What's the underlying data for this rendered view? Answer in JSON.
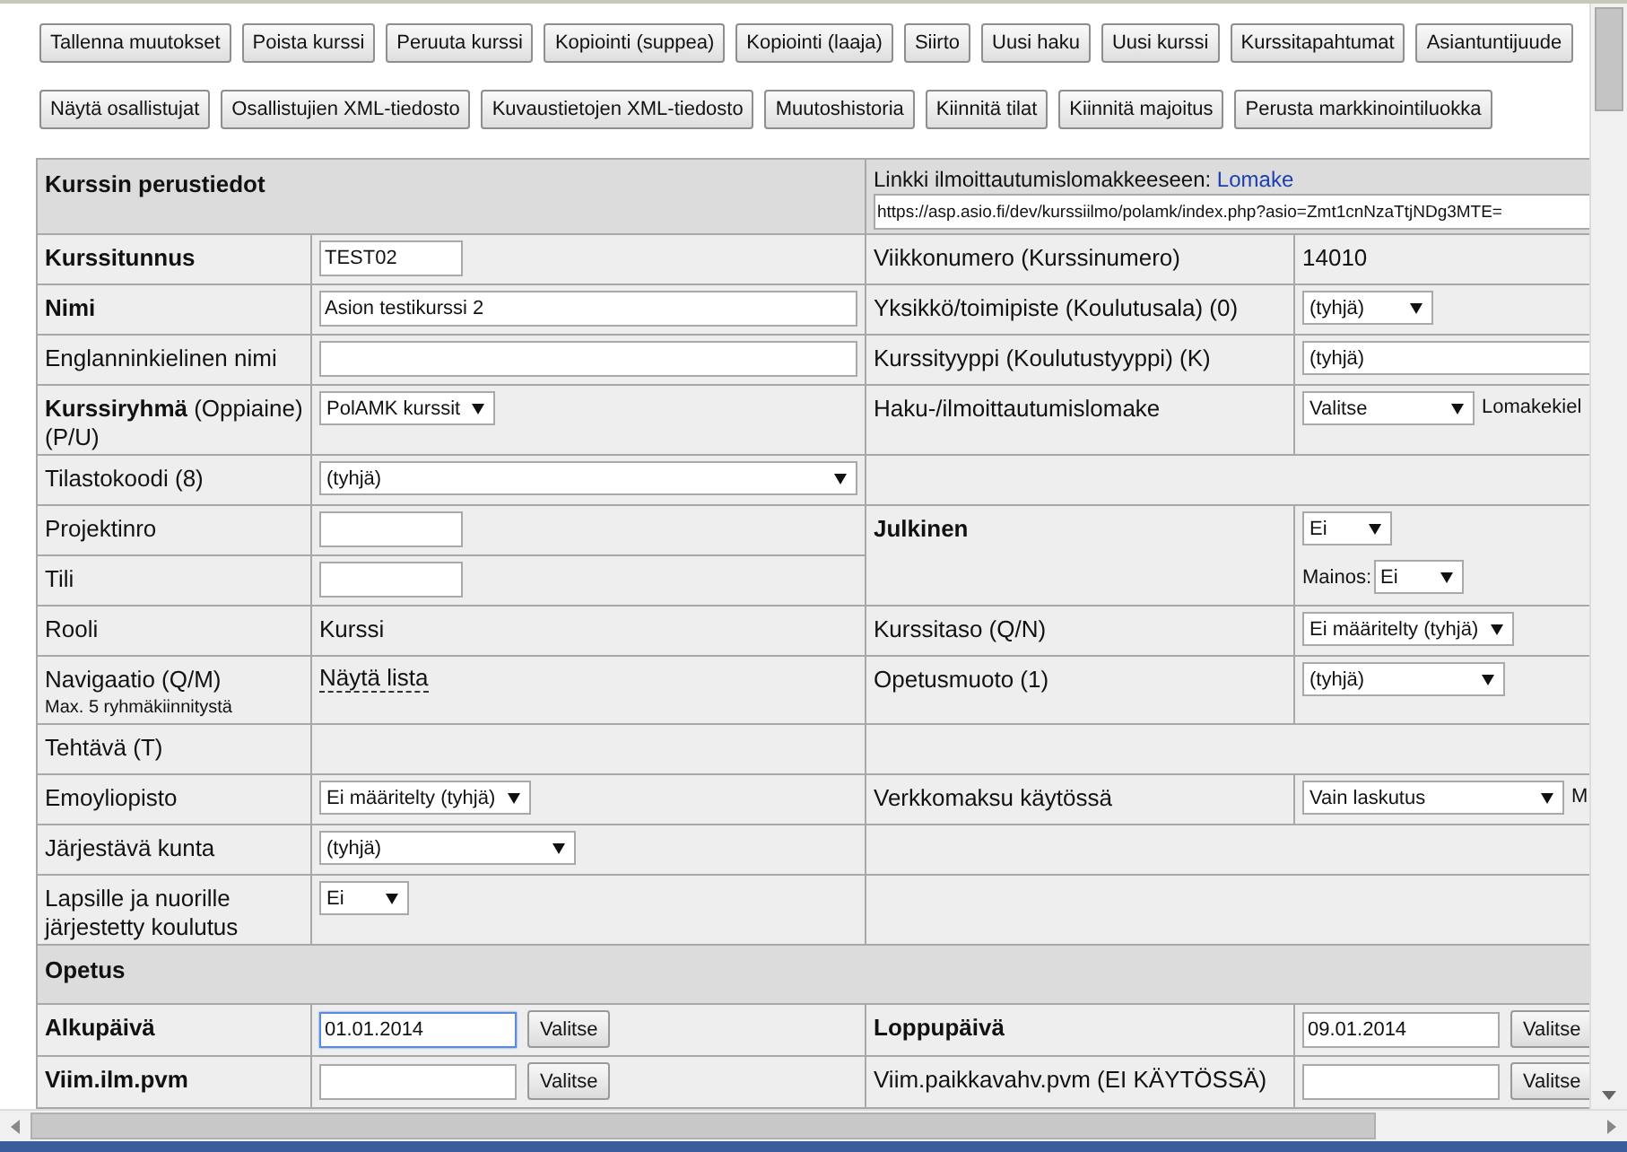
{
  "toolbar": [
    [
      "Tallenna muutokset",
      "Poista kurssi",
      "Peruuta kurssi",
      "Kopiointi (suppea)",
      "Kopiointi (laaja)",
      "Siirto",
      "Uusi haku",
      "Uusi kurssi",
      "Kurssitapahtumat",
      "Asiantuntijuude"
    ],
    [
      "Näytä osallistujat",
      "Osallistujien XML-tiedosto",
      "Kuvaustietojen XML-tiedosto",
      "Muutoshistoria",
      "Kiinnitä tilat",
      "Kiinnitä majoitus",
      "Perusta markkinointiluokka"
    ]
  ],
  "sections": [
    {
      "title": "Kurssin perustiedot",
      "link": {
        "caption": "Linkki ilmoittautumislomakkeeseen:",
        "text": "Lomake",
        "url": "https://asp.asio.fi/dev/kurssiilmo/polamk/index.php?asio=Zmt1cnNzaTtjNDg3MTE="
      },
      "rows": [
        {
          "label": "Kurssitunnus",
          "bold": true,
          "controls": [
            {
              "kind": "input",
              "value": "TEST02",
              "focused": false
            }
          ],
          "right": {
            "label": "Viikkonumero (Kurssinumero)",
            "bold": false,
            "controls": [
              {
                "kind": "static",
                "value": "14010"
              }
            ]
          }
        },
        {
          "label": "Nimi",
          "bold": true,
          "controls": [
            {
              "kind": "input",
              "value": "Asion testikurssi 2",
              "focused": false
            }
          ],
          "right": {
            "label": "Yksikkö/toimipiste (Koulutusala) (0)",
            "bold": false,
            "controls": [
              {
                "kind": "select",
                "value": "(tyhjä)"
              }
            ]
          }
        },
        {
          "label": "Englanninkielinen nimi",
          "bold": false,
          "controls": [
            {
              "kind": "input",
              "focused": false
            }
          ],
          "right": {
            "label": "Kurssityyppi (Koulutustyyppi) (K)",
            "bold": false,
            "controls": [
              {
                "kind": "select",
                "value": "(tyhjä)"
              }
            ]
          }
        },
        {
          "label": "**Kurssiryhmä** (Oppiaine) (P/U)",
          "bold": false,
          "controls": [
            {
              "kind": "select",
              "value": "PolAMK kurssit"
            }
          ],
          "right": {
            "label": "Haku-/ilmoittautumislomake",
            "bold": false,
            "controls": [
              {
                "kind": "select",
                "value": "Valitse"
              },
              {
                "kind": "text",
                "value": "Lomakekiel"
              }
            ]
          }
        },
        {
          "label": "Tilastokoodi (8)",
          "bold": false,
          "controls": [
            {
              "kind": "select",
              "value": "(tyhjä)"
            }
          ]
        },
        {
          "label": "Projektinro",
          "bold": false,
          "controls": [
            {
              "kind": "input",
              "focused": false
            }
          ],
          "right": {
            "label": "Julkinen",
            "bold": true,
            "rowspan": 2,
            "controls": [
              {
                "kind": "select",
                "value": "Ei"
              },
              {
                "kind": "select",
                "label": "Mainos:",
                "value": "Ei"
              }
            ]
          }
        },
        {
          "label": "Tili",
          "bold": false,
          "controls": [
            {
              "kind": "input",
              "focused": false
            }
          ]
        },
        {
          "label": "Rooli",
          "bold": false,
          "controls": [
            {
              "kind": "static",
              "value": "Kurssi"
            }
          ],
          "right": {
            "label": "Kurssitaso (Q/N)",
            "bold": false,
            "controls": [
              {
                "kind": "select",
                "value": "Ei määritelty (tyhjä)"
              }
            ]
          }
        },
        {
          "label": "Navigaatio (Q/M)",
          "note": "Max. 5 ryhmäkiinnitystä",
          "bold": false,
          "controls": [
            {
              "kind": "link",
              "value": "Näytä lista"
            }
          ],
          "right": {
            "label": "Opetusmuoto (1)",
            "bold": false,
            "controls": [
              {
                "kind": "select",
                "value": "(tyhjä)"
              }
            ]
          }
        },
        {
          "label": "Tehtävä (T)",
          "bold": false
        },
        {
          "label": "Emoyliopisto",
          "bold": false,
          "controls": [
            {
              "kind": "select",
              "value": "Ei määritelty (tyhjä)"
            }
          ],
          "right": {
            "label": "Verkkomaksu käytössä",
            "bold": false,
            "controls": [
              {
                "kind": "select",
                "value": "Vain laskutus"
              },
              {
                "kind": "text",
                "value": "M"
              }
            ]
          }
        },
        {
          "label": "Järjestävä kunta",
          "bold": false,
          "controls": [
            {
              "kind": "select",
              "value": "(tyhjä)"
            }
          ]
        },
        {
          "label": "Lapsille ja nuorille järjestetty koulutus",
          "bold": false,
          "controls": [
            {
              "kind": "select",
              "value": "Ei"
            }
          ]
        }
      ]
    },
    {
      "title": "Opetus",
      "rows": [
        {
          "label": "Alkupäivä",
          "bold": true,
          "controls": [
            {
              "kind": "date",
              "value": "01.01.2014",
              "button": "Valitse",
              "focused": true
            }
          ],
          "right": {
            "label": "Loppupäivä",
            "bold": true,
            "controls": [
              {
                "kind": "date",
                "value": "09.01.2014",
                "button": "Valitse",
                "focused": false
              }
            ]
          }
        },
        {
          "label": "Viim.ilm.pvm",
          "bold": true,
          "controls": [
            {
              "kind": "date",
              "button": "Valitse",
              "focused": false
            }
          ],
          "right": {
            "label": "Viim.paikkavahv.pvm (EI KÄYTÖSSÄ)",
            "bold": false,
            "controls": [
              {
                "kind": "date",
                "button": "Valitse",
                "focused": false
              }
            ]
          }
        }
      ]
    }
  ]
}
